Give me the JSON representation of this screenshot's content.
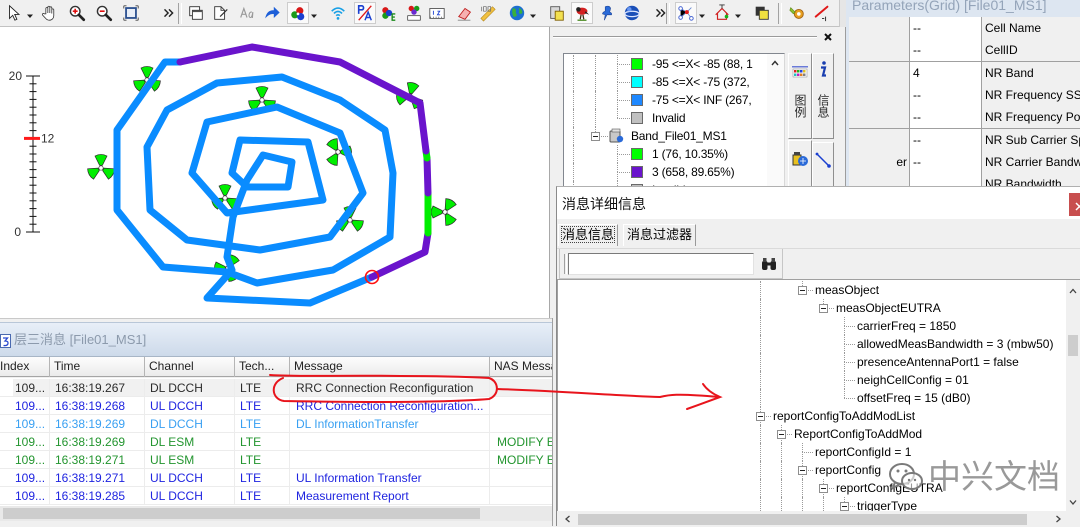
{
  "toolbar": {
    "buttons": [
      {
        "icon": "pointer-icon",
        "dropdown": true
      },
      {
        "icon": "pan-hand-icon"
      },
      {
        "icon": "zoom-in-icon"
      },
      {
        "icon": "zoom-out-icon"
      },
      {
        "icon": "full-extent-icon"
      },
      {
        "icon": "more-chevron-icon"
      },
      {
        "separator": true
      },
      {
        "icon": "copy-window-icon"
      },
      {
        "icon": "edit-window-icon"
      },
      {
        "icon": "text-style-icon"
      },
      {
        "icon": "redo-arrow-icon"
      },
      {
        "icon": "sector-site-icon",
        "dropdown": true,
        "pressed": true
      },
      {
        "icon": "wifi-signal-icon"
      },
      {
        "icon": "pa-label-icon",
        "pressed": true
      },
      {
        "icon": "sector-edit-icon"
      },
      {
        "icon": "site-label-icon"
      },
      {
        "icon": "ruler-numbers-icon"
      },
      {
        "icon": "eraser-icon"
      },
      {
        "icon": "measure-ruler-icon"
      },
      {
        "icon": "globe-icon",
        "dropdown": true
      },
      {
        "icon": "clipboard-icon"
      },
      {
        "icon": "parrot-icon",
        "pressed": true
      },
      {
        "icon": "pushpin-icon"
      },
      {
        "icon": "earth-ball-icon"
      },
      {
        "icon": "more-chevron-icon"
      },
      {
        "separator": true
      },
      {
        "icon": "graph-nodes-icon",
        "dropdown": true,
        "pressed": true
      },
      {
        "icon": "house-antenna-icon",
        "dropdown": true
      },
      {
        "icon": "layers-icon"
      },
      {
        "separator": true
      },
      {
        "icon": "gear-wrench-icon"
      },
      {
        "icon": "red-line-icon"
      }
    ]
  },
  "map": {
    "scale_bar": {
      "min": 0,
      "max": 20,
      "marker": 12,
      "max_label": "20",
      "marker_label": "12",
      "min_label": "0",
      "marker_color": "#ff1a1a"
    },
    "route_colors": {
      "default": "#0a8cff",
      "band_3": "#6a14cc",
      "band_1": "#00ee00"
    },
    "site_color": "#00ee00",
    "current_marker_color": "#ff1010"
  },
  "legend_panel": {
    "tree": [
      {
        "level": 2,
        "swatch": "#00ff00",
        "label": "-95 <=X< -85  (88,  1"
      },
      {
        "level": 2,
        "swatch": "#00ffff",
        "label": "-85 <=X< -75  (372,"
      },
      {
        "level": 2,
        "swatch": "#1e88ff",
        "label": "-75 <=X< INF  (267,"
      },
      {
        "level": 2,
        "swatch": "#c0c0c0",
        "label": "Invalid"
      },
      {
        "level": 1,
        "expanded": true,
        "icon": "device-icon",
        "label": "Band_File01_MS1"
      },
      {
        "level": 2,
        "swatch": "#00ff00",
        "label": "1 (76,  10.35%)"
      },
      {
        "level": 2,
        "swatch": "#6a14cc",
        "label": "3 (658,  89.65%)"
      },
      {
        "level": 2,
        "swatch": "#c0c0c0",
        "label": "Invalid"
      }
    ],
    "tabs": [
      {
        "label": "图例",
        "icon": "legend-grid-icon",
        "active": true
      },
      {
        "label": "信息",
        "icon": "info-icon"
      },
      {
        "label": "",
        "icon": "device-info-icon"
      },
      {
        "label": "",
        "icon": "line-tool-icon"
      }
    ]
  },
  "params_grid": {
    "title": "Parameters(Grid) [File01_MS1]",
    "rows": [
      {
        "label": "",
        "value": "--",
        "name": "Cell Name"
      },
      {
        "label": "",
        "value": "--",
        "name": "CellID"
      },
      {
        "label": "",
        "value": "4",
        "name": "NR Band"
      },
      {
        "label": "",
        "value": "--",
        "name": "NR Frequency SSB"
      },
      {
        "label": "",
        "value": "--",
        "name": "NR Frequency Poi"
      },
      {
        "label": "",
        "value": "--",
        "name": "NR Sub Carrier Sp"
      },
      {
        "label": "er",
        "value": "--",
        "name": "NR Carrier Bandw"
      },
      {
        "label": "",
        "value": "",
        "name": "NR Bandwidth"
      }
    ]
  },
  "l3_panel": {
    "title": "层三消息 [File01_MS1]",
    "columns": [
      "Index",
      "Time",
      "Channel",
      "Tech...",
      "Message",
      "NAS Messa"
    ],
    "rows": [
      {
        "index": "109...",
        "time": "16:38:19.267",
        "channel": "DL DCCH",
        "tech": "LTE",
        "message": "RRC Connection Reconfiguration",
        "nas": "",
        "color": "#2b2b2b",
        "selected": true
      },
      {
        "index": "109...",
        "time": "16:38:19.268",
        "channel": "UL DCCH",
        "tech": "LTE",
        "message": "RRC Connection Reconfiguration...",
        "nas": "",
        "color": "#1f24e0"
      },
      {
        "index": "109...",
        "time": "16:38:19.269",
        "channel": "DL DCCH",
        "tech": "LTE",
        "message": "DL InformationTransfer",
        "nas": "",
        "color": "#39a0f2"
      },
      {
        "index": "109...",
        "time": "16:38:19.269",
        "channel": "DL ESM",
        "tech": "LTE",
        "message": "",
        "nas": "MODIFY E",
        "color": "#23952f"
      },
      {
        "index": "109...",
        "time": "16:38:19.271",
        "channel": "UL ESM",
        "tech": "LTE",
        "message": "",
        "nas": "MODIFY E",
        "color": "#23952f"
      },
      {
        "index": "109...",
        "time": "16:38:19.271",
        "channel": "UL DCCH",
        "tech": "LTE",
        "message": "UL Information Transfer",
        "nas": "",
        "color": "#1f24e0"
      },
      {
        "index": "109...",
        "time": "16:38:19.285",
        "channel": "UL DCCH",
        "tech": "LTE",
        "message": "Measurement Report",
        "nas": "",
        "color": "#1f24e0"
      }
    ]
  },
  "detail_dialog": {
    "title": "消息详细信息",
    "tabs": [
      {
        "label": "消息信息",
        "active": true
      },
      {
        "label": "消息过滤器",
        "active": false
      }
    ],
    "search": {
      "value": "",
      "placeholder": ""
    },
    "tree": [
      {
        "level": 2,
        "expanded": true,
        "label": "measObject"
      },
      {
        "level": 3,
        "expanded": true,
        "label": "measObjectEUTRA"
      },
      {
        "level": 4,
        "label": "carrierFreq = 1850"
      },
      {
        "level": 4,
        "label": "allowedMeasBandwidth = 3 (mbw50)"
      },
      {
        "level": 4,
        "label": "presenceAntennaPort1 = false"
      },
      {
        "level": 4,
        "label": "neighCellConfig  = 01"
      },
      {
        "level": 4,
        "label": "offsetFreq = 15 (dB0)"
      },
      {
        "level": 0,
        "expanded": true,
        "label": "reportConfigToAddModList"
      },
      {
        "level": 1,
        "expanded": true,
        "label": "ReportConfigToAddMod"
      },
      {
        "level": 2,
        "label": "reportConfigId = 1"
      },
      {
        "level": 2,
        "expanded": true,
        "label": "reportConfig"
      },
      {
        "level": 3,
        "expanded": true,
        "label": "reportConfigEUTRA"
      },
      {
        "level": 4,
        "expanded": true,
        "label": "triggerType"
      }
    ]
  },
  "watermark": {
    "text": "中兴文档"
  },
  "annotations": {
    "color": "#e8141c"
  }
}
